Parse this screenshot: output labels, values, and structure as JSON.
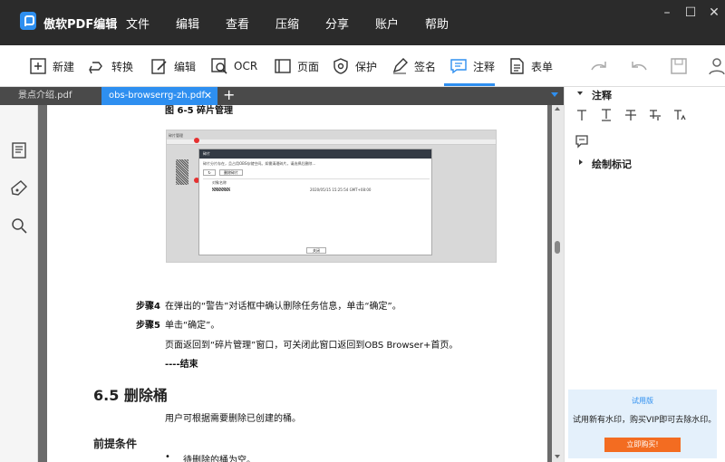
{
  "app": {
    "title": "傲软PDF编辑"
  },
  "menu": [
    "文件",
    "编辑",
    "查看",
    "压缩",
    "分享",
    "账户",
    "帮助"
  ],
  "toolbar": {
    "new_label": "新建",
    "convert_label": "转换",
    "edit_label": "编辑",
    "ocr_label": "OCR",
    "page_label": "页面",
    "protect_label": "保护",
    "sign_label": "签名",
    "annotate_label": "注释",
    "form_label": "表单"
  },
  "tabs": [
    {
      "label": "景点介绍.pdf",
      "active": false
    },
    {
      "label": "obs-browserrg-zh.pdf",
      "active": true
    }
  ],
  "document": {
    "figure_caption": "图 6-5 碎片管理",
    "screenshot": {
      "toolbar_text": "碎片管理",
      "dialog_title": "碎片",
      "warn_text": "碎片分片存在，且占用OBS存储空间。如需清理碎片，请选择后删除...",
      "delete_btn": "删除碎片",
      "ok_btn": "关闭",
      "row_date": "2020/05/15 15:25:54 GMT+08:00",
      "col_name": "对象名称"
    },
    "step4_label": "步骤4",
    "step4_text": "在弹出的“警告”对话框中确认删除任务信息，单击“确定”。",
    "step5_label": "步骤5",
    "step5_text": "单击“确定”。",
    "step5_desc": "页面返回到“碎片管理”窗口，可关闭此窗口返回到OBS Browser+首页。",
    "end_text": "----结束",
    "section_title": "6.5 删除桶",
    "section_desc": "用户可根据需要删除已创建的桶。",
    "prereq_title": "前提条件",
    "bullet_text": "待删除的桶为空。"
  },
  "right_panel": {
    "annot_title": "注释",
    "draw_title": "绘制标记",
    "trial_title": "试用版",
    "trial_text": "试用新有水印，购买VIP即可去除水印。",
    "buy_button": "立即购买!"
  },
  "colors": {
    "accent": "#2e8ff0",
    "buy": "#f36c21",
    "titlebar": "#2b2b2b"
  }
}
